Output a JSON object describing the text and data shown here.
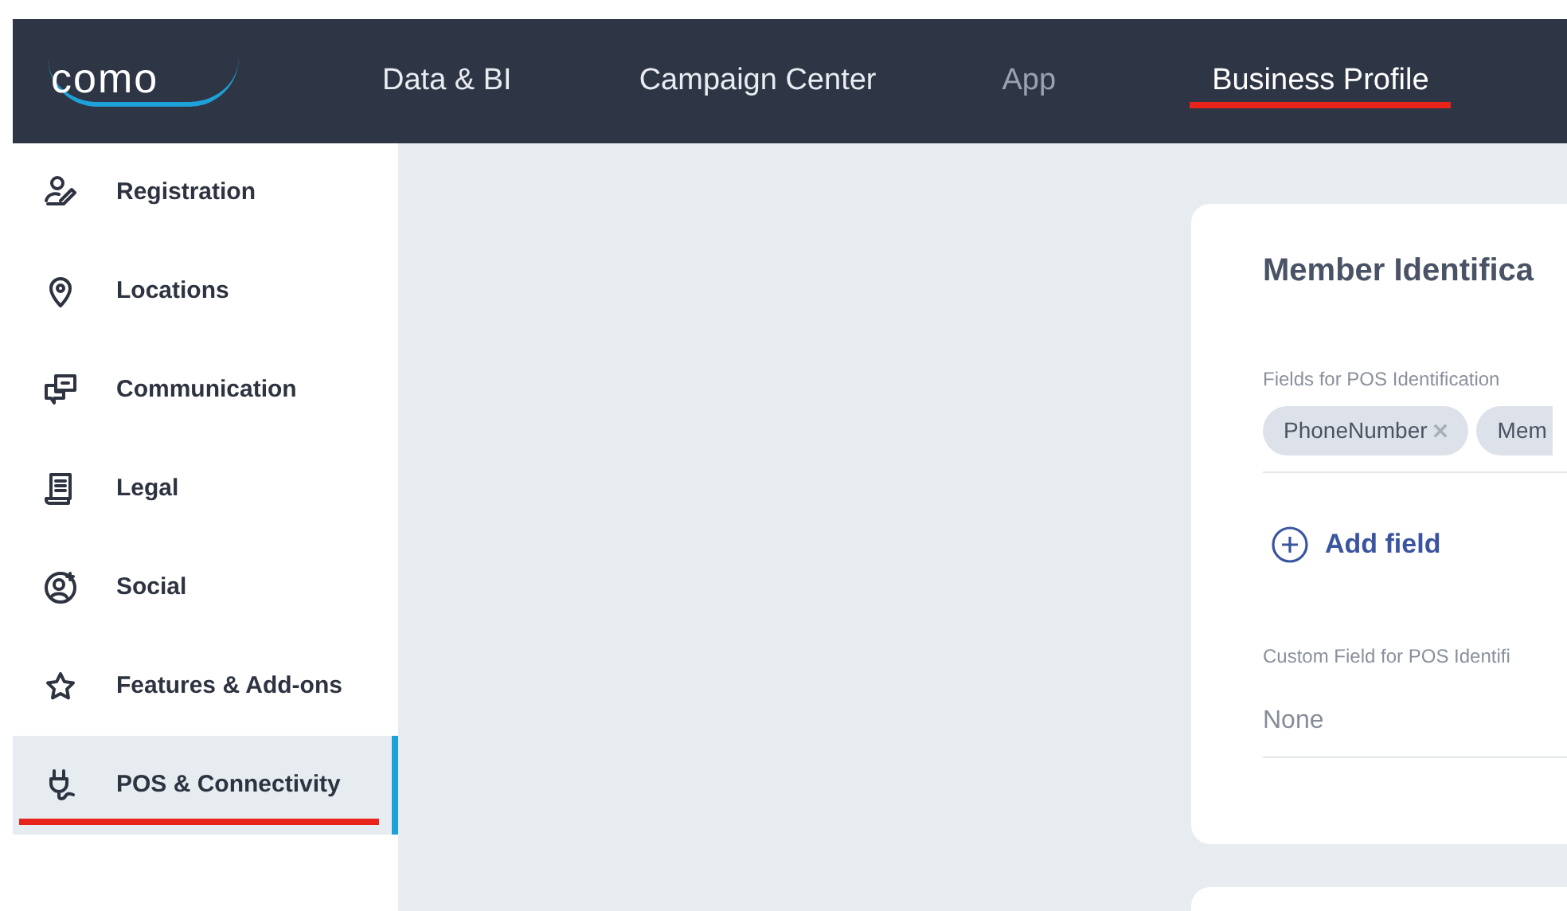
{
  "logo": {
    "text": "como"
  },
  "nav": [
    {
      "label": "Data & BI",
      "selected": false,
      "disabled": false,
      "annotated": false
    },
    {
      "label": "Campaign Center",
      "selected": false,
      "disabled": false,
      "annotated": false
    },
    {
      "label": "App",
      "selected": false,
      "disabled": true,
      "annotated": false
    },
    {
      "label": "Business Profile",
      "selected": true,
      "disabled": false,
      "annotated": true
    }
  ],
  "sidebar": {
    "items": [
      {
        "label": "Registration",
        "selected": false,
        "annotated": false
      },
      {
        "label": "Locations",
        "selected": false,
        "annotated": false
      },
      {
        "label": "Communication",
        "selected": false,
        "annotated": false
      },
      {
        "label": "Legal",
        "selected": false,
        "annotated": false
      },
      {
        "label": "Social",
        "selected": false,
        "annotated": false
      },
      {
        "label": "Features & Add-ons",
        "selected": false,
        "annotated": false
      },
      {
        "label": "POS & Connectivity",
        "selected": true,
        "annotated": true
      }
    ]
  },
  "card": {
    "title": "Member Identifica",
    "fields_label": "Fields for POS Identification",
    "chips": [
      {
        "label": "PhoneNumber",
        "removable": true
      },
      {
        "label": "Mem"
      }
    ],
    "add_button": {
      "label": "Add field"
    },
    "custom_label": "Custom Field for POS Identifi",
    "custom_value": "None"
  }
}
